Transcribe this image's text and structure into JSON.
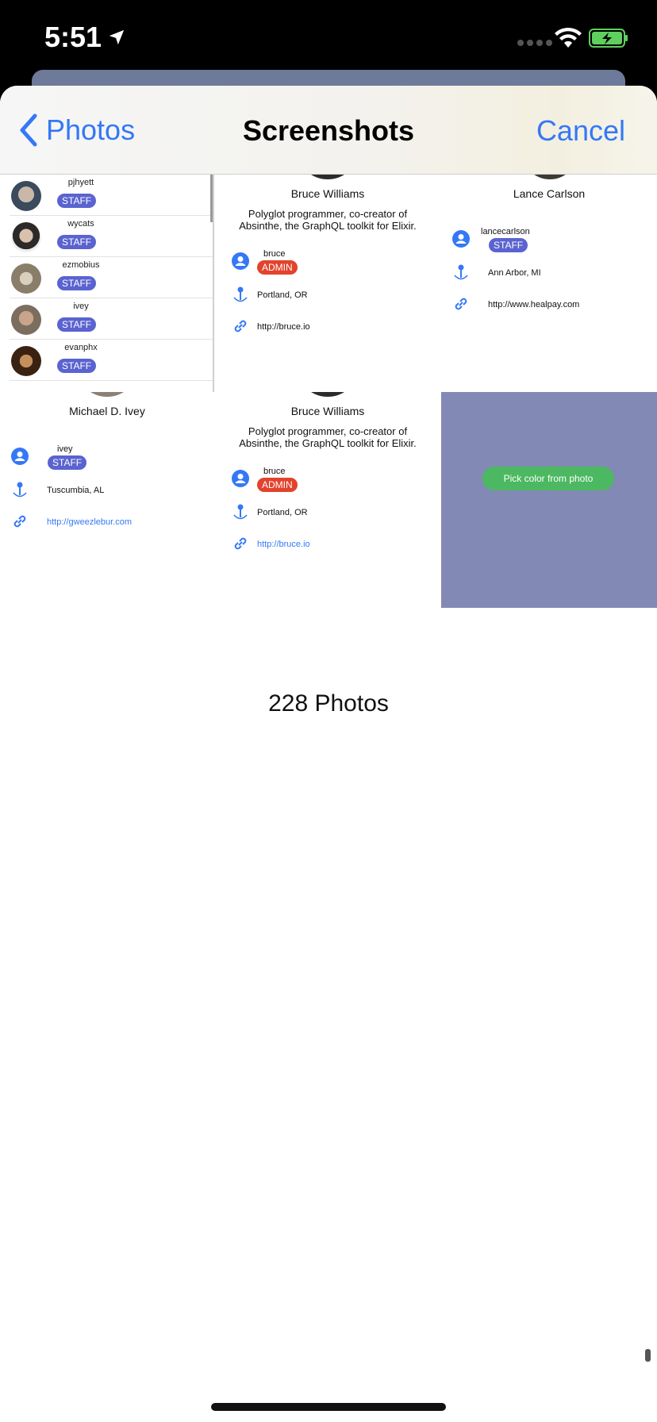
{
  "status": {
    "time": "5:51"
  },
  "navbar": {
    "back_label": "Photos",
    "title": "Screenshots",
    "cancel_label": "Cancel"
  },
  "user_list": [
    {
      "name": "pjhyett",
      "badge": "STAFF"
    },
    {
      "name": "wycats",
      "badge": "STAFF"
    },
    {
      "name": "ezmobius",
      "badge": "STAFF"
    },
    {
      "name": "ivey",
      "badge": "STAFF"
    },
    {
      "name": "evanphx",
      "badge": "STAFF"
    }
  ],
  "bruce_top": {
    "name": "Bruce Williams",
    "bio": "Polyglot programmer, co-creator of Absinthe, the GraphQL toolkit for Elixir.",
    "username": "bruce",
    "badge": "ADMIN",
    "location": "Portland, OR",
    "url": "http://bruce.io"
  },
  "lance": {
    "name": "Lance Carlson",
    "username": "lancecarlson",
    "badge": "STAFF",
    "location": "Ann Arbor, MI",
    "url": "http://www.healpay.com"
  },
  "michael": {
    "name": "Michael D. Ivey",
    "username": "ivey",
    "badge": "STAFF",
    "location": "Tuscumbia, AL",
    "url": "http://gweezlebur.com"
  },
  "bruce_bottom": {
    "name": "Bruce Williams",
    "bio": "Polyglot programmer, co-creator of Absinthe, the GraphQL toolkit for Elixir.",
    "username": "bruce",
    "badge": "ADMIN",
    "location": "Portland, OR",
    "url": "http://bruce.io"
  },
  "color_picker": {
    "button_label": "Pick color from photo",
    "bg_color": "#8289b5"
  },
  "photo_count": "228 Photos",
  "colors": {
    "accent": "#3478f6",
    "staff_badge": "#5a63cf",
    "admin_badge": "#e2432c",
    "pick_button": "#4cb861"
  }
}
